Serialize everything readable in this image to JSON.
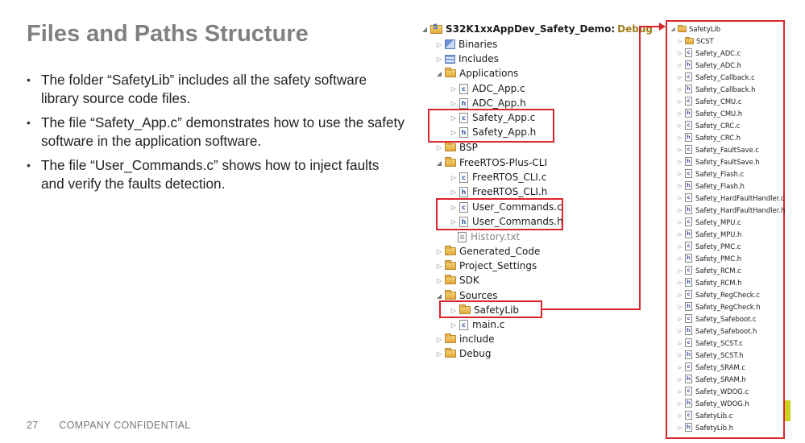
{
  "slide": {
    "title": "Files and Paths Structure",
    "bullets": [
      "The folder “SafetyLib” includes all the safety software library source code files.",
      "The file “Safety_App.c” demonstrates how to use the safety software in the application software.",
      "The file “User_Commands.c” shows how to inject faults and verify the faults detection."
    ]
  },
  "footer": {
    "page_number": "27",
    "confidential": "COMPANY CONFIDENTIAL"
  },
  "colors": {
    "title": "#808080",
    "highlight": "#d9252b",
    "accent": "#c8d21e"
  },
  "project_tree": {
    "project_name": "S32K1xxAppDev_Safety_Demo:",
    "build_config": "Debug",
    "items": [
      {
        "label": "Binaries",
        "icon": "binaries-icon"
      },
      {
        "label": "Includes",
        "icon": "includes-icon"
      },
      {
        "label": "Applications",
        "icon": "folder-icon"
      },
      {
        "label": "ADC_App.c",
        "icon": "c-file-icon",
        "type": "c"
      },
      {
        "label": "ADC_App.h",
        "icon": "h-file-icon",
        "type": "h"
      },
      {
        "label": "Safety_App.c",
        "icon": "c-file-icon",
        "type": "c"
      },
      {
        "label": "Safety_App.h",
        "icon": "h-file-icon",
        "type": "h"
      },
      {
        "label": "BSP",
        "icon": "folder-icon"
      },
      {
        "label": "FreeRTOS-Plus-CLI",
        "icon": "folder-icon"
      },
      {
        "label": "FreeRTOS_CLI.c",
        "icon": "c-file-icon",
        "type": "c"
      },
      {
        "label": "FreeRTOS_CLI.h",
        "icon": "h-file-icon",
        "type": "h"
      },
      {
        "label": "User_Commands.c",
        "icon": "c-file-icon",
        "type": "c"
      },
      {
        "label": "User_Commands.h",
        "icon": "h-file-icon",
        "type": "h"
      },
      {
        "label": "History.txt",
        "icon": "text-file-icon"
      },
      {
        "label": "Generated_Code",
        "icon": "folder-icon"
      },
      {
        "label": "Project_Settings",
        "icon": "folder-icon"
      },
      {
        "label": "SDK",
        "icon": "folder-icon"
      },
      {
        "label": "Sources",
        "icon": "folder-icon"
      },
      {
        "label": "SafetyLib",
        "icon": "folder-icon"
      },
      {
        "label": "main.c",
        "icon": "c-file-icon",
        "type": "c"
      },
      {
        "label": "include",
        "icon": "folder-icon"
      },
      {
        "label": "Debug",
        "icon": "folder-icon"
      }
    ]
  },
  "safetylib_tree": {
    "root": "SafetyLib",
    "items": [
      {
        "label": "SCST",
        "type": "folder"
      },
      {
        "label": "Safety_ADC.c",
        "type": "c"
      },
      {
        "label": "Safety_ADC.h",
        "type": "h"
      },
      {
        "label": "Safety_Callback.c",
        "type": "c"
      },
      {
        "label": "Safety_Callback.h",
        "type": "h"
      },
      {
        "label": "Safety_CMU.c",
        "type": "c"
      },
      {
        "label": "Safety_CMU.h",
        "type": "h"
      },
      {
        "label": "Safety_CRC.c",
        "type": "c"
      },
      {
        "label": "Safety_CRC.h",
        "type": "h"
      },
      {
        "label": "Safety_FaultSave.c",
        "type": "c"
      },
      {
        "label": "Safety_FaultSave.h",
        "type": "h"
      },
      {
        "label": "Safety_Flash.c",
        "type": "c"
      },
      {
        "label": "Safety_Flash.h",
        "type": "h"
      },
      {
        "label": "Safety_HardFaultHandler.c",
        "type": "c"
      },
      {
        "label": "Safety_HardFaultHandler.h",
        "type": "h"
      },
      {
        "label": "Safety_MPU.c",
        "type": "c"
      },
      {
        "label": "Safety_MPU.h",
        "type": "h"
      },
      {
        "label": "Safety_PMC.c",
        "type": "c"
      },
      {
        "label": "Safety_PMC.h",
        "type": "h"
      },
      {
        "label": "Safety_RCM.c",
        "type": "c"
      },
      {
        "label": "Safety_RCM.h",
        "type": "h"
      },
      {
        "label": "Safety_RegCheck.c",
        "type": "c"
      },
      {
        "label": "Safety_RegCheck.h",
        "type": "h"
      },
      {
        "label": "Safety_Safeboot.c",
        "type": "c"
      },
      {
        "label": "Safety_Safeboot.h",
        "type": "h"
      },
      {
        "label": "Safety_SCST.c",
        "type": "c"
      },
      {
        "label": "Safety_SCST.h",
        "type": "h"
      },
      {
        "label": "Safety_SRAM.c",
        "type": "c"
      },
      {
        "label": "Safety_SRAM.h",
        "type": "h"
      },
      {
        "label": "Safety_WDOG.c",
        "type": "c"
      },
      {
        "label": "Safety_WDOG.h",
        "type": "h"
      },
      {
        "label": "SafetyLib.c",
        "type": "c"
      },
      {
        "label": "SafetyLib.h",
        "type": "h"
      }
    ]
  }
}
